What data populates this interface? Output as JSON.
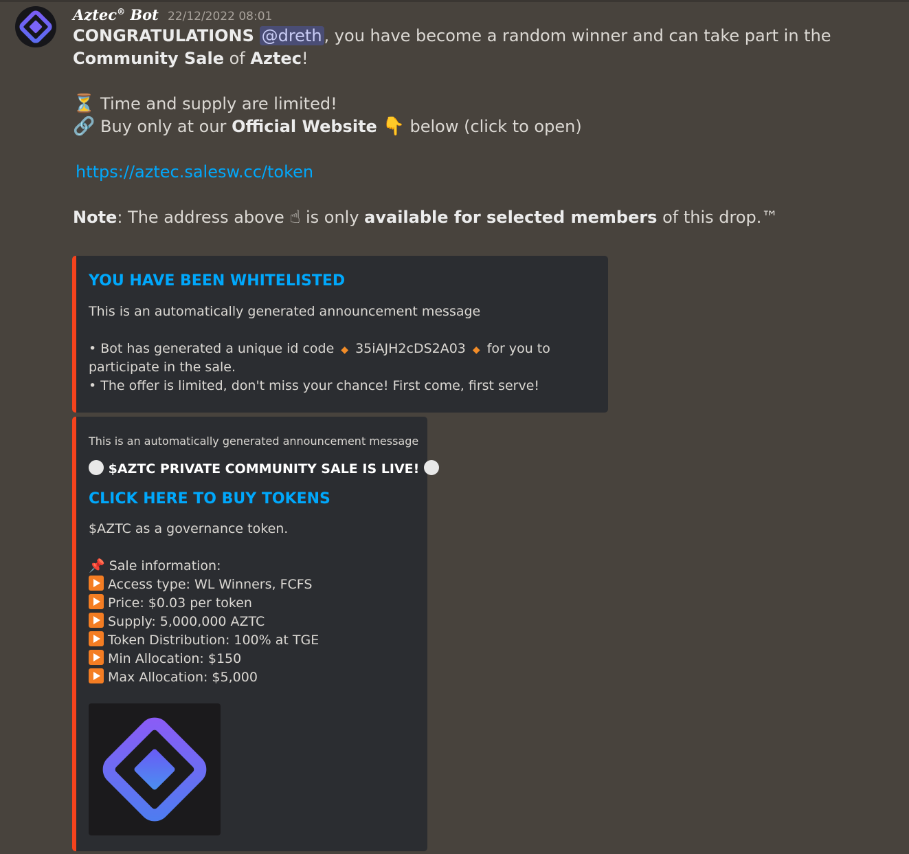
{
  "message": {
    "bot_name": "Aztec",
    "bot_suffix": "Bot",
    "registered_mark": "®",
    "timestamp": "22/12/2022 08:01",
    "line1_prefix": "CONGRATULATIONS",
    "mention": "@dreth",
    "line1_mid": ", you have become a random winner and can take part in the",
    "line1_bold": "Community Sale",
    "line1_of": "of",
    "line1_bold2": "Aztec",
    "line1_end": "!",
    "line2": "Time and supply are limited!",
    "line3_prefix": "Buy only at our",
    "line3_bold": "Official Website",
    "line3_suffix": "below (click to open)",
    "link": "https://aztec.salesw.cc/token",
    "note_label": "Note",
    "note_text1": ": The address above",
    "note_text2": "is only",
    "note_bold": "available for selected members",
    "note_text3": "of this drop.™"
  },
  "embed1": {
    "title": "YOU HAVE BEEN WHITELISTED",
    "desc": "This is an automatically generated announcement message",
    "bullet1_a": "• Bot has generated a unique id code",
    "code": "35iAJH2cDS2A03",
    "bullet1_b": "for you to",
    "bullet1_c": "participate in the sale.",
    "bullet2": "• The offer is limited, don't miss your chance! First come, first serve!"
  },
  "embed2": {
    "author": "This is an automatically generated announcement message",
    "headline": "$AZTC PRIVATE COMMUNITY SALE IS LIVE!",
    "title": "CLICK HERE TO BUY TOKENS",
    "desc": "$AZTC as a governance token.",
    "sale_info": "Sale information:",
    "items": [
      "Access type: WL Winners, FCFS",
      "Price: $0.03 per token",
      "Supply: 5,000,000 AZTC",
      "Token Distribution: 100% at TGE",
      "Min Allocation: $150",
      "Max Allocation: $5,000"
    ]
  },
  "colors": {
    "background": "#48433d",
    "embed_bg": "#2b2d31",
    "accent_bar": "#f5431d",
    "link": "#00a8fc",
    "mention_bg": "#4a4d75"
  },
  "icons": {
    "avatar": "aztec-diamond-logo",
    "hourglass": "hourglass-icon",
    "link": "link-icon",
    "pointing_down": "pointing-down-icon",
    "pointing_up": "pointing-up-icon",
    "pushpin": "pushpin-icon",
    "play_button": "play-button-icon"
  }
}
